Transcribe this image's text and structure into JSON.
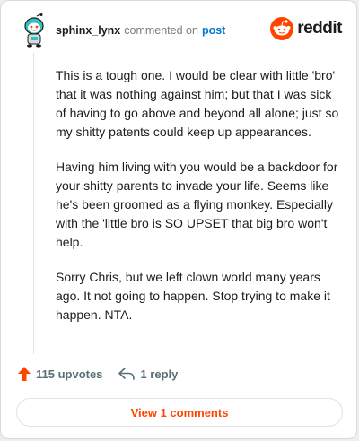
{
  "header": {
    "username": "sphinx_lynx",
    "action": "commented on",
    "target": "post",
    "logo_text": "reddit"
  },
  "comment": {
    "paragraphs": [
      "This is a tough one. I would be clear with little 'bro' that it was nothing against him; but that I was sick of having to go above and beyond all alone; just so my shitty patents could keep up appearances.",
      "Having him living with you would be a backdoor for your shitty parents to invade your life. Seems like he's been groomed as a flying monkey. Especially with the 'little bro is SO UPSET that big bro won't help.",
      "Sorry Chris, but we left clown world many years ago. It not going to happen. Stop trying to make it happen. NTA."
    ]
  },
  "actions": {
    "upvotes": "115 upvotes",
    "replies": "1 reply"
  },
  "footer": {
    "view_comments": "View 1 comments"
  },
  "colors": {
    "reddit_orange": "#ff4500",
    "link_blue": "#0079d3",
    "avatar_teal": "#2ec4c4"
  },
  "icons": [
    "avatar-snoo",
    "reddit-logo-icon",
    "upvote-arrow-icon",
    "reply-icon"
  ]
}
